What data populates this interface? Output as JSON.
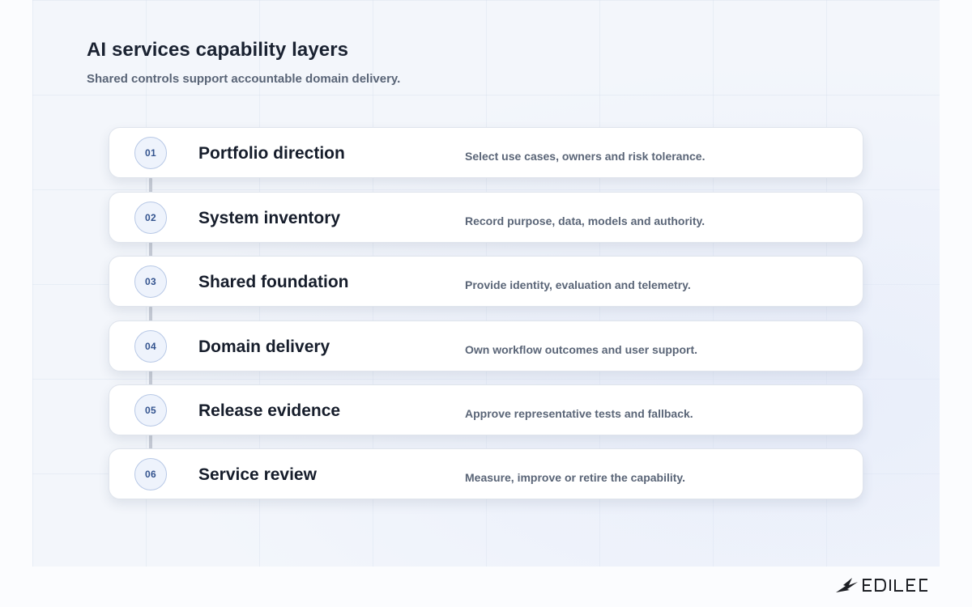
{
  "header": {
    "title": "AI services capability layers",
    "subtitle": "Shared controls support accountable domain delivery."
  },
  "layers": [
    {
      "number": "01",
      "title": "Portfolio direction",
      "description": "Select use cases, owners and risk tolerance."
    },
    {
      "number": "02",
      "title": "System inventory",
      "description": "Record purpose, data, models and authority."
    },
    {
      "number": "03",
      "title": "Shared foundation",
      "description": "Provide identity, evaluation and telemetry."
    },
    {
      "number": "04",
      "title": "Domain delivery",
      "description": "Own workflow outcomes and user support."
    },
    {
      "number": "05",
      "title": "Release evidence",
      "description": "Approve representative tests and fallback."
    },
    {
      "number": "06",
      "title": "Service review",
      "description": "Measure, improve or retire the capability."
    }
  ],
  "brand": {
    "logo_text": "EDILEC",
    "logo_icon": "bird-wing-icon"
  },
  "colors": {
    "badge_text": "#34548f",
    "badge_fill": "#eef3fc",
    "title_text": "#1a2231",
    "muted_text": "#5a6577"
  }
}
